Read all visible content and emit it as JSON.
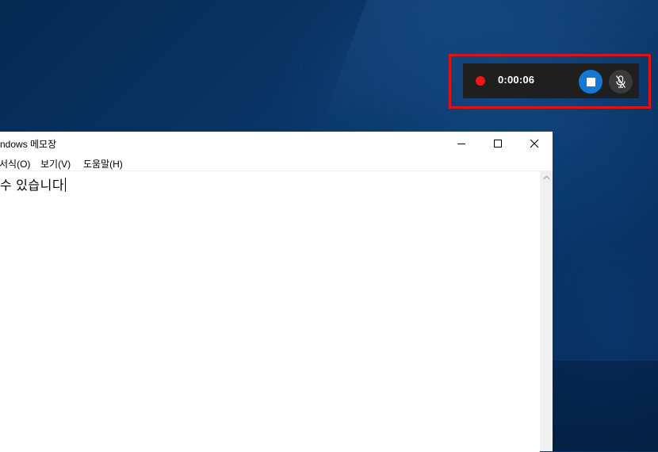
{
  "capture_widget": {
    "timer": "0:00:06",
    "recording_color": "#f01414",
    "stop_button_color": "#1478d4",
    "highlight_color": "#e01313",
    "icons": [
      "recording-indicator-icon",
      "stop-icon",
      "microphone-muted-icon"
    ]
  },
  "notepad": {
    "title": "ndows 메모장",
    "menu": {
      "format": "서식(O)",
      "view": "보기(V)",
      "help": "도움말(H)"
    },
    "content": "수 있습니다",
    "controls": [
      "minimize-icon",
      "maximize-icon",
      "close-icon"
    ]
  }
}
